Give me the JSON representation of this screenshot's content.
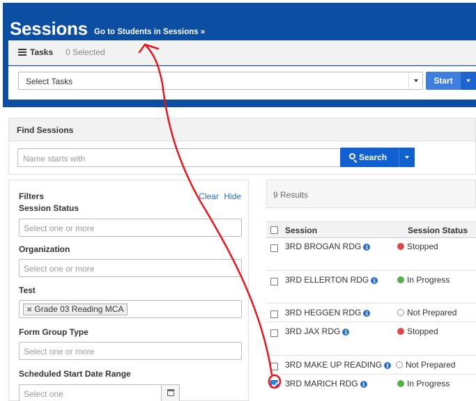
{
  "header": {
    "title": "Sessions",
    "link": "Go to Students in Sessions »"
  },
  "tasks": {
    "label": "Tasks",
    "count": "0 Selected",
    "select_placeholder": "Select Tasks",
    "start_label": "Start"
  },
  "find": {
    "title": "Find Sessions",
    "name_placeholder": "Name starts with",
    "search_label": "Search"
  },
  "filters": {
    "title": "Filters",
    "clear": "Clear",
    "hide": "Hide",
    "session_status": {
      "label": "Session Status",
      "placeholder": "Select one or more"
    },
    "organization": {
      "label": "Organization",
      "placeholder": "Select one or more"
    },
    "test": {
      "label": "Test",
      "chip": "Grade 03 Reading MCA"
    },
    "form_group_type": {
      "label": "Form Group Type",
      "placeholder": "Select one or more"
    },
    "date_range": {
      "label": "Scheduled Start Date Range",
      "placeholder": "Select one"
    }
  },
  "results": {
    "count": "9 Results",
    "columns": {
      "session": "Session",
      "status": "Session Status"
    },
    "rows": [
      {
        "name": "3RD BROGAN RDG",
        "status": "Stopped",
        "checked": false
      },
      {
        "name": "3RD ELLERTON RDG",
        "status": "In Progress",
        "checked": false
      },
      {
        "name": "3RD HEGGEN RDG",
        "status": "Not Prepared",
        "checked": false
      },
      {
        "name": "3RD JAX RDG",
        "status": "Stopped",
        "checked": false
      },
      {
        "name": "3RD MAKE UP READING",
        "status": "Not Prepared",
        "checked": false
      },
      {
        "name": "3RD MARICH RDG",
        "status": "In Progress",
        "checked": true
      }
    ]
  },
  "colors": {
    "header_blue": "#0b4ea2",
    "button_blue": "#3e7fe0",
    "stopped": "#e04848",
    "in_progress": "#55b04a",
    "annotation": "#e8141c"
  }
}
